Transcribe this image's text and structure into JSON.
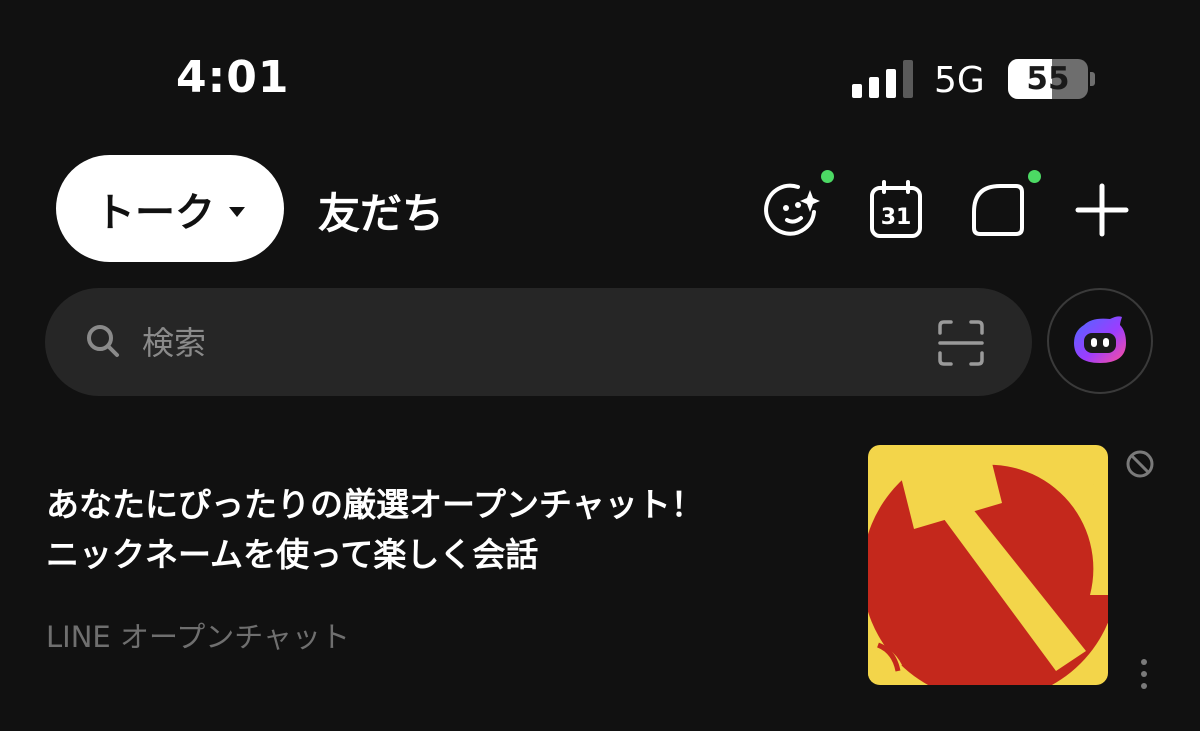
{
  "status_bar": {
    "time": "4:01",
    "network": "5G",
    "battery_level": "55",
    "battery_fraction": 0.55,
    "signal_bars_active": 3,
    "signal_bars_total": 4
  },
  "header": {
    "tabs": [
      {
        "label": "トーク",
        "active": true
      },
      {
        "label": "友だち",
        "active": false
      }
    ],
    "actions": [
      {
        "name": "face-sparkle-icon",
        "notification": true
      },
      {
        "name": "calendar-icon",
        "day": "31",
        "notification": false
      },
      {
        "name": "chat-bubble-icon",
        "notification": true
      },
      {
        "name": "plus-icon",
        "notification": false
      }
    ]
  },
  "search": {
    "placeholder": "検索"
  },
  "ad": {
    "title_lines": [
      "あなたにぴったりの厳選オープンチャット！",
      "ニックネームを使って楽しく会話"
    ],
    "source": "LINE オープンチャット"
  },
  "colors": {
    "background": "#111111",
    "search_background": "#262626",
    "notification_dot": "#4cd964",
    "secondary_text": "#6f6f6f",
    "ad_image_red": "#c4281c",
    "ad_image_yellow": "#f3d54a"
  }
}
